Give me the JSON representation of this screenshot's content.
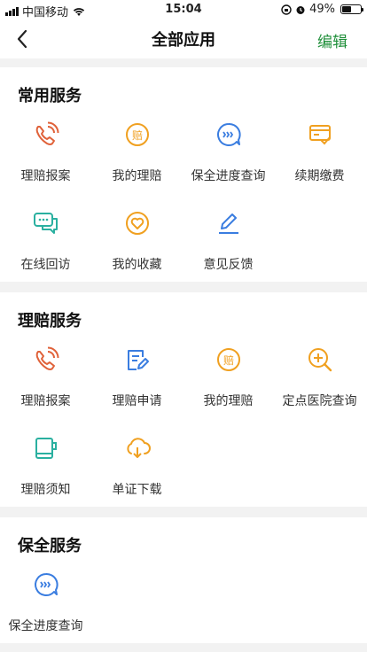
{
  "status": {
    "carrier": "中国移动",
    "time": "15:04",
    "battery": "49%",
    "battery_level": 0.49
  },
  "nav": {
    "title": "全部应用",
    "edit": "编辑"
  },
  "sections": [
    {
      "title": "常用服务",
      "items": [
        "理赔报案",
        "我的理赔",
        "保全进度查询",
        "续期缴费",
        "在线回访",
        "我的收藏",
        "意见反馈"
      ]
    },
    {
      "title": "理赔服务",
      "items": [
        "理赔报案",
        "理赔申请",
        "我的理赔",
        "定点医院查询",
        "理赔须知",
        "单证下载"
      ]
    },
    {
      "title": "保全服务",
      "items": [
        "保全进度查询"
      ]
    }
  ],
  "icons": {
    "phone-icon": "#e0623a",
    "claim-coin-icon": "#f0a020",
    "progress-chat-icon": "#3a7de0",
    "renewal-icon": "#f0a020",
    "chat-icon": "#2ab0a0",
    "favorite-icon": "#f0a020",
    "feedback-icon": "#3a7de0",
    "claim-apply-icon": "#3a7de0",
    "hospital-search-icon": "#f0a020",
    "notice-icon": "#2ab0a0",
    "download-icon": "#f0a020"
  }
}
